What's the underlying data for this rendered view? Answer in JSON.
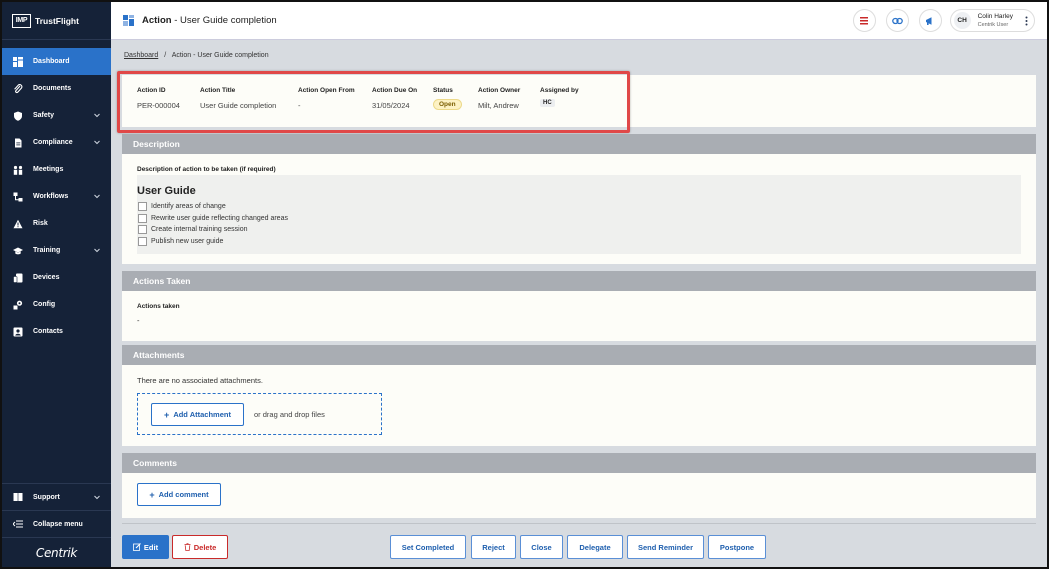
{
  "sidebar": {
    "logo_mark": "IMP",
    "brand": "TrustFlight",
    "items": [
      {
        "label": "Dashboard",
        "icon": "dashboard-icon",
        "active": true
      },
      {
        "label": "Documents",
        "icon": "paperclip-icon"
      },
      {
        "label": "Safety",
        "icon": "shield-icon",
        "chevron": true
      },
      {
        "label": "Compliance",
        "icon": "document-icon",
        "chevron": true
      },
      {
        "label": "Meetings",
        "icon": "people-icon"
      },
      {
        "label": "Workflows",
        "icon": "workflow-icon",
        "chevron": true
      },
      {
        "label": "Risk",
        "icon": "risk-icon"
      },
      {
        "label": "Training",
        "icon": "graduation-cap-icon",
        "chevron": true
      },
      {
        "label": "Devices",
        "icon": "devices-icon"
      },
      {
        "label": "Config",
        "icon": "config-icon"
      },
      {
        "label": "Contacts",
        "icon": "contacts-icon"
      }
    ],
    "support": "Support",
    "collapse": "Collapse menu",
    "footer_brand": "Centrik"
  },
  "topbar": {
    "title_bold": "Action",
    "title_rest": " - User Guide completion",
    "user_initials": "CH",
    "user_name": "Colin Harley",
    "user_role": "Centrik User"
  },
  "breadcrumb": {
    "link": "Dashboard",
    "separator": "/",
    "current": "Action - User Guide completion"
  },
  "info": {
    "action_id_label": "Action ID",
    "action_id": "PER-000004",
    "title_label": "Action Title",
    "title": "User Guide completion",
    "open_from_label": "Action Open From",
    "open_from": "-",
    "due_label": "Action Due On",
    "due": "31/05/2024",
    "status_label": "Status",
    "status": "Open",
    "owner_label": "Action Owner",
    "owner": "Milt, Andrew",
    "assigned_label": "Assigned by",
    "assigned": "HC"
  },
  "description": {
    "header": "Description",
    "label": "Description of action to be taken (if required)",
    "heading": "User Guide",
    "items": [
      "Identify areas of change",
      "Rewrite user guide reflecting changed areas",
      "Create internal training session",
      "Publish new user guide"
    ]
  },
  "actions_taken": {
    "header": "Actions Taken",
    "label": "Actions taken",
    "value": "-"
  },
  "attachments": {
    "header": "Attachments",
    "note": "There are no associated attachments.",
    "add_label": "Add Attachment",
    "drag_text": "or drag and drop files"
  },
  "comments": {
    "header": "Comments",
    "add_label": "Add comment"
  },
  "footer": {
    "edit": "Edit",
    "delete": "Delete",
    "set_completed": "Set Completed",
    "reject": "Reject",
    "close": "Close",
    "delegate": "Delegate",
    "send_reminder": "Send Reminder",
    "postpone": "Postpone"
  },
  "colors": {
    "sidebar_bg": "#152238",
    "accent": "#2a72c9",
    "danger": "#c92a2a",
    "highlight": "#e04848"
  }
}
